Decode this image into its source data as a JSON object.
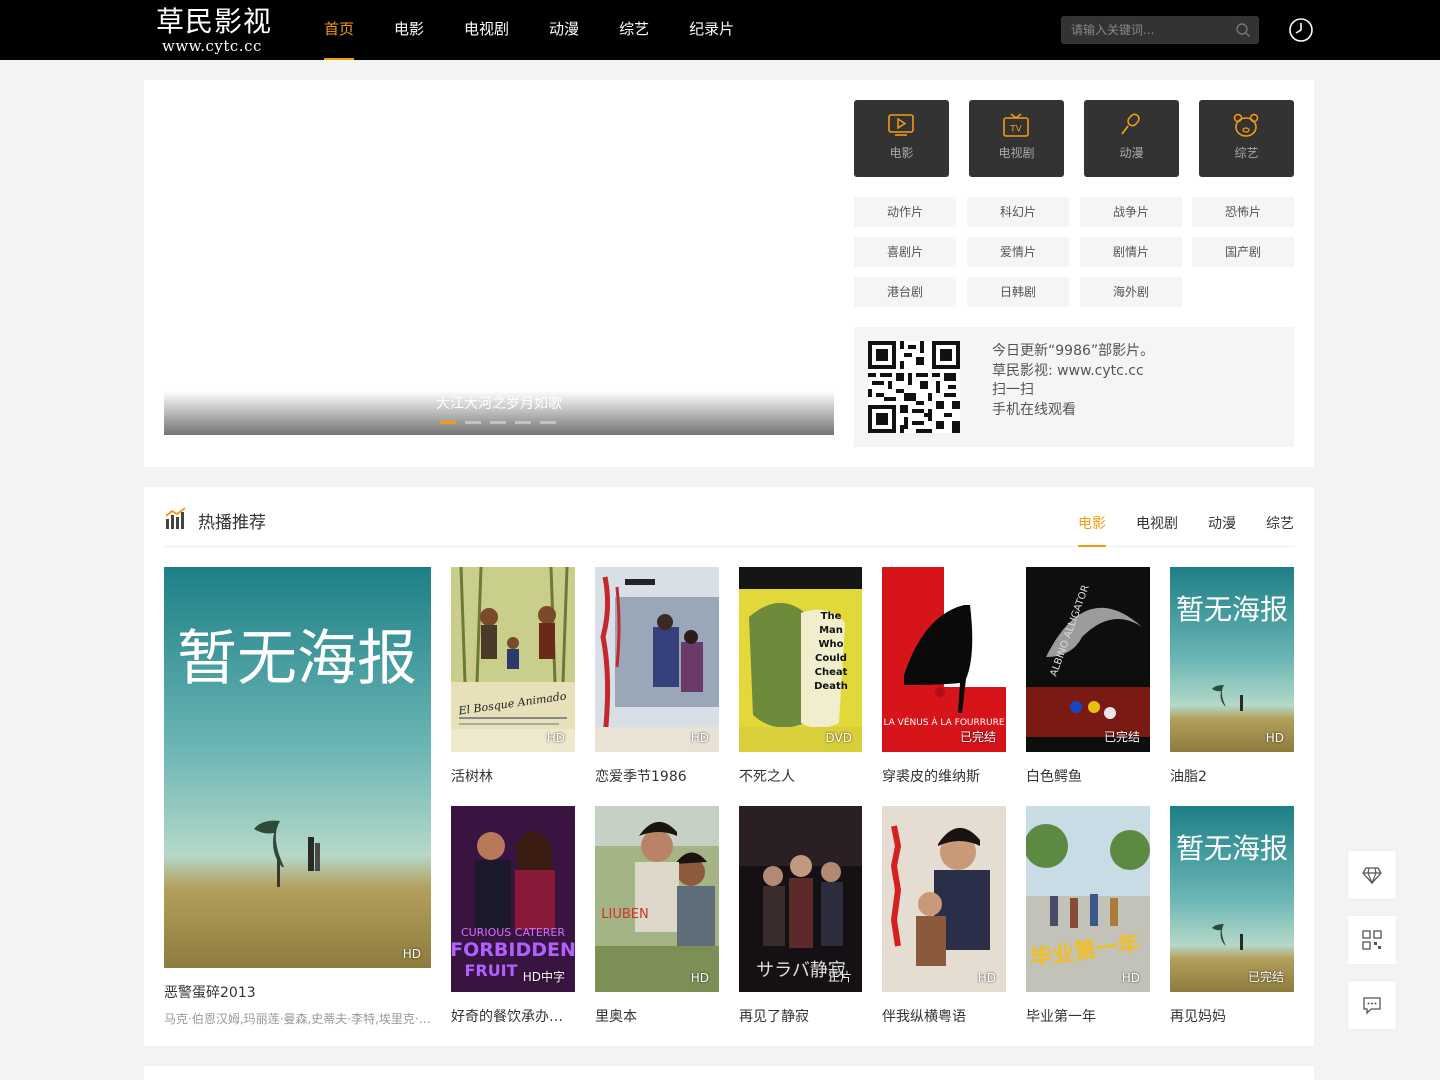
{
  "header": {
    "logo_title": "草民影视",
    "logo_url": "www.cytc.cc",
    "nav": [
      {
        "label": "首页",
        "active": true
      },
      {
        "label": "电影",
        "active": false
      },
      {
        "label": "电视剧",
        "active": false
      },
      {
        "label": "动漫",
        "active": false
      },
      {
        "label": "综艺",
        "active": false
      },
      {
        "label": "纪录片",
        "active": false
      }
    ],
    "search_placeholder": "请输入关键词...",
    "accent_color": "#f39c12"
  },
  "slider": {
    "caption": "大江大河之岁月如歌",
    "dots": 5,
    "active_dot": 0
  },
  "categories": [
    {
      "label": "电影",
      "icon": "play-screen-icon"
    },
    {
      "label": "电视剧",
      "icon": "tv-icon"
    },
    {
      "label": "动漫",
      "icon": "microphone-icon"
    },
    {
      "label": "综艺",
      "icon": "bear-icon"
    }
  ],
  "genres": [
    "动作片",
    "科幻片",
    "战争片",
    "恐怖片",
    "喜剧片",
    "爱情片",
    "剧情片",
    "国产剧",
    "港台剧",
    "日韩剧",
    "海外剧"
  ],
  "app": {
    "line1": "今日更新“9986”部影片。",
    "line2": "草民影视: www.cytc.cc",
    "line3": "扫一扫",
    "line4": "手机在线观看"
  },
  "hot": {
    "title": "热播推荐",
    "tabs": [
      {
        "label": "电影",
        "active": true
      },
      {
        "label": "电视剧",
        "active": false
      },
      {
        "label": "动漫",
        "active": false
      },
      {
        "label": "综艺",
        "active": false
      }
    ],
    "featured": {
      "poster_text": "暂无海报",
      "badge": "HD",
      "title": "恶警蛋碎2013",
      "actors": "马克·伯恩汉姆,玛丽莲·曼森,史蒂夫·李特,埃里克·罗伯茨"
    },
    "items": [
      {
        "title": "活树林",
        "badge": "HD",
        "poster_text": "El Bosque Animado"
      },
      {
        "title": "恋爱季节1986",
        "badge": "HD",
        "poster_text": ""
      },
      {
        "title": "不死之人",
        "badge": "DVD",
        "poster_text": "The Man Who Could Cheat Death"
      },
      {
        "title": "穿裘皮的维纳斯",
        "badge": "已完结",
        "poster_text": "LA VÉNUS À LA FOURRURE"
      },
      {
        "title": "白色鳄鱼",
        "badge": "已完结",
        "poster_text": "ALBINO ALLIGATOR"
      },
      {
        "title": "油脂2",
        "badge": "HD",
        "poster_text": "暂无海报"
      },
      {
        "title": "好奇的餐饮承办商：禁果",
        "badge": "HD中字",
        "poster_text": "CURIOUS CATERER FORBIDDEN FRUIT"
      },
      {
        "title": "里奥本",
        "badge": "HD",
        "poster_text": "LIUBEN"
      },
      {
        "title": "再见了静寂",
        "badge": "正片",
        "poster_text": "サラバ静寂"
      },
      {
        "title": "伴我纵横粤语",
        "badge": "HD",
        "poster_text": ""
      },
      {
        "title": "毕业第一年",
        "badge": "HD",
        "poster_text": "毕业第一年"
      },
      {
        "title": "再见妈妈",
        "badge": "已完结",
        "poster_text": "暂无海报"
      }
    ]
  }
}
